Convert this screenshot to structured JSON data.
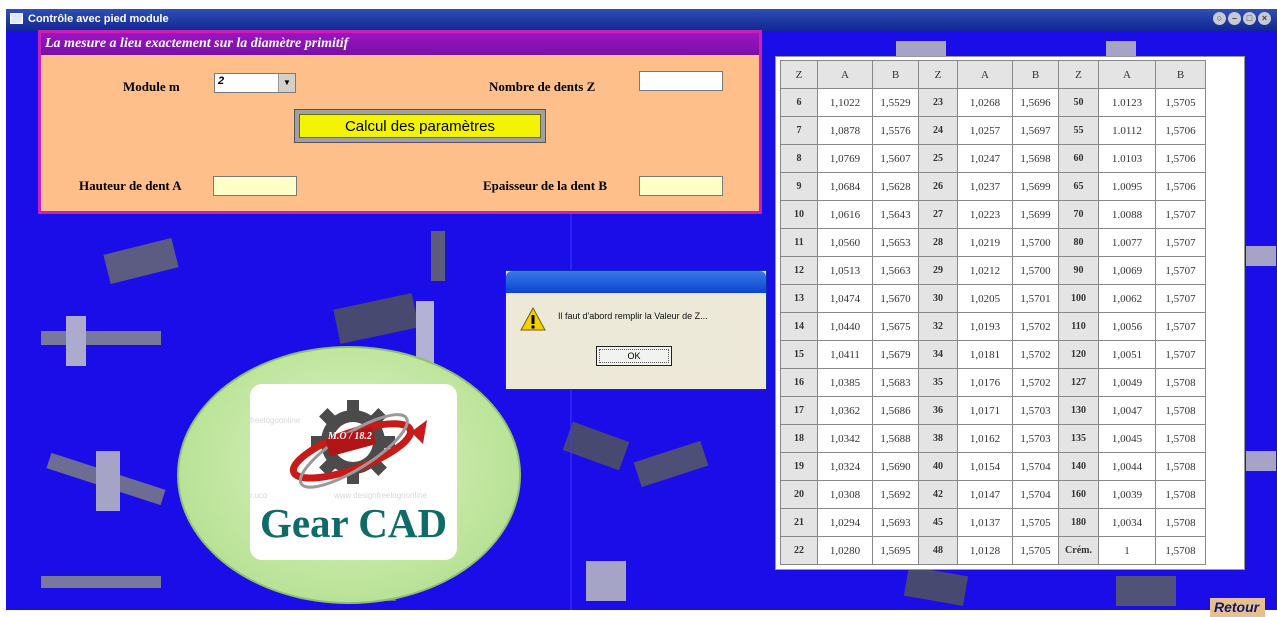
{
  "window": {
    "title": "Contrôle  avec pied module",
    "controls": [
      "○",
      "–",
      "□",
      "×"
    ]
  },
  "form": {
    "header": "La mesure a lieu exactement sur la diamètre primitif",
    "module_label": "Module m",
    "module_value": "2",
    "nombre_label": "Nombre de dents Z",
    "nombre_value": "",
    "calc_label": "Calcul des paramètres",
    "hauteur_label": "Hauteur de dent  A",
    "hauteur_value": "",
    "epaisseur_label": "Epaisseur de la dent B",
    "epaisseur_value": ""
  },
  "dialog": {
    "message": "Il faut d'abord remplir la Valeur de Z...",
    "ok_label": "OK"
  },
  "logo": {
    "title": "Gear CAD",
    "badge": "M.O / 18.2",
    "watermark1": "freelogoonline",
    "watermark2": "r.uco",
    "watermark3": "www.designfreelogoonline"
  },
  "retour_label": "Retour",
  "table": {
    "headers": [
      "Z",
      "A",
      "B",
      "Z",
      "A",
      "B",
      "Z",
      "A",
      "B"
    ],
    "rows": [
      [
        "6",
        "1,1022",
        "1,5529",
        "23",
        "1,0268",
        "1,5696",
        "50",
        "1.0123",
        "1,5705"
      ],
      [
        "7",
        "1,0878",
        "1,5576",
        "24",
        "1,0257",
        "1,5697",
        "55",
        "1.0112",
        "1,5706"
      ],
      [
        "8",
        "1,0769",
        "1,5607",
        "25",
        "1,0247",
        "1,5698",
        "60",
        "1.0103",
        "1,5706"
      ],
      [
        "9",
        "1,0684",
        "1,5628",
        "26",
        "1,0237",
        "1,5699",
        "65",
        "1.0095",
        "1,5706"
      ],
      [
        "10",
        "1,0616",
        "1,5643",
        "27",
        "1,0223",
        "1,5699",
        "70",
        "1.0088",
        "1,5707"
      ],
      [
        "11",
        "1,0560",
        "1,5653",
        "28",
        "1,0219",
        "1,5700",
        "80",
        "1.0077",
        "1,5707"
      ],
      [
        "12",
        "1,0513",
        "1,5663",
        "29",
        "1,0212",
        "1,5700",
        "90",
        "1,0069",
        "1,5707"
      ],
      [
        "13",
        "1,0474",
        "1,5670",
        "30",
        "1,0205",
        "1,5701",
        "100",
        "1,0062",
        "1,5707"
      ],
      [
        "14",
        "1,0440",
        "1,5675",
        "32",
        "1,0193",
        "1,5702",
        "110",
        "1,0056",
        "1,5707"
      ],
      [
        "15",
        "1,0411",
        "1,5679",
        "34",
        "1,0181",
        "1,5702",
        "120",
        "1,0051",
        "1,5707"
      ],
      [
        "16",
        "1,0385",
        "1,5683",
        "35",
        "1,0176",
        "1,5702",
        "127",
        "1,0049",
        "1,5708"
      ],
      [
        "17",
        "1,0362",
        "1,5686",
        "36",
        "1,0171",
        "1,5703",
        "130",
        "1,0047",
        "1,5708"
      ],
      [
        "18",
        "1,0342",
        "1,5688",
        "38",
        "1,0162",
        "1,5703",
        "135",
        "1,0045",
        "1,5708"
      ],
      [
        "19",
        "1,0324",
        "1,5690",
        "40",
        "1,0154",
        "1,5704",
        "140",
        "1,0044",
        "1,5708"
      ],
      [
        "20",
        "1,0308",
        "1,5692",
        "42",
        "1,0147",
        "1,5704",
        "160",
        "1,0039",
        "1,5708"
      ],
      [
        "21",
        "1,0294",
        "1,5693",
        "45",
        "1,0137",
        "1,5705",
        "180",
        "1,0034",
        "1,5708"
      ],
      [
        "22",
        "1,0280",
        "1,5695",
        "48",
        "1,0128",
        "1,5705",
        "Crém.",
        "1",
        "1,5708"
      ]
    ]
  },
  "colors": {
    "desktop": "#1a0de8",
    "panel": "#ffbf8a",
    "panel_border": "#cc1fb5",
    "header": "#9a15c2",
    "button_yellow": "#f4f400",
    "logo_teal": "#0f6b68"
  },
  "icons": [
    "app-icon",
    "warning-icon",
    "gear-logo-icon"
  ]
}
